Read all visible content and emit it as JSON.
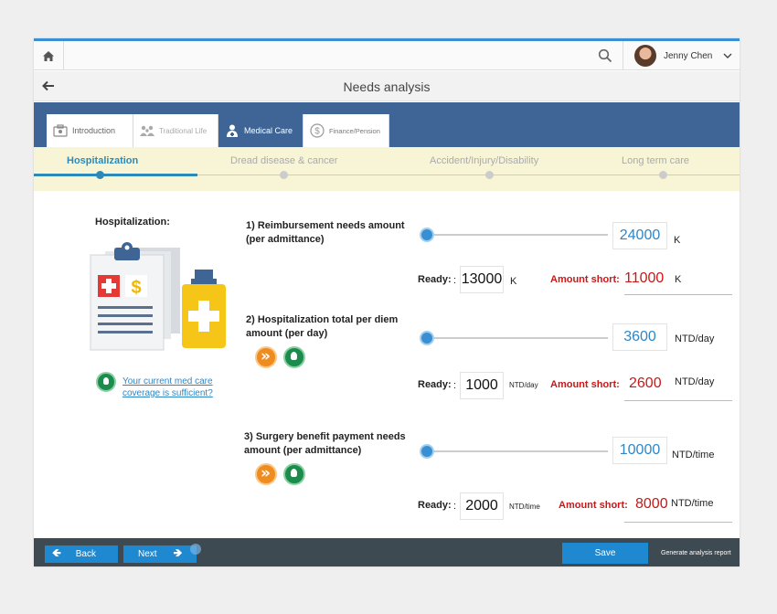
{
  "header": {
    "user_name": "Jenny Chen"
  },
  "page": {
    "title": "Needs analysis"
  },
  "tabs": [
    {
      "label": "Introduction"
    },
    {
      "label": "Traditional Life"
    },
    {
      "label": "Medical Care"
    },
    {
      "label": "Finance/Pension"
    }
  ],
  "steps": [
    {
      "label": "Hospitalization"
    },
    {
      "label": "Dread disease & cancer"
    },
    {
      "label": "Accident/Injury/Disability"
    },
    {
      "label": "Long term care"
    }
  ],
  "left_panel": {
    "heading": "Hospitalization:",
    "tip_link": "Your current med care coverage is sufficient?"
  },
  "questions": [
    {
      "label": "1) Reimbursement needs amount (per admittance)",
      "value": "24000",
      "unit": "K",
      "ready_label": "Ready:",
      "ready_sep": ":",
      "ready_value": "13000",
      "ready_unit": "K",
      "short_label": "Amount short:",
      "short_value": "11000",
      "short_unit": "K"
    },
    {
      "label": "2) Hospitalization total per diem amount (per day)",
      "value": "3600",
      "unit": "NTD/day",
      "ready_label": "Ready:",
      "ready_sep": ":",
      "ready_value": "1000",
      "ready_unit": "NTD/day",
      "short_label": "Amount short:",
      "short_value": "2600",
      "short_unit": "NTD/day"
    },
    {
      "label": "3) Surgery benefit payment needs amount (per admittance)",
      "value": "10000",
      "unit": "NTD/time",
      "ready_label": "Ready:",
      "ready_sep": ":",
      "ready_value": "2000",
      "ready_unit": "NTD/time",
      "short_label": "Amount short:",
      "short_value": "8000",
      "short_unit": "NTD/time"
    }
  ],
  "footer": {
    "back_label": "Back",
    "next_label": "Next",
    "save_label": "Save",
    "generate_label": "Generate analysis report"
  },
  "colors": {
    "accent": "#1e88d0",
    "header_blue": "#3f6596",
    "short_red": "#c81818",
    "step_bg": "#f7f5d6"
  }
}
